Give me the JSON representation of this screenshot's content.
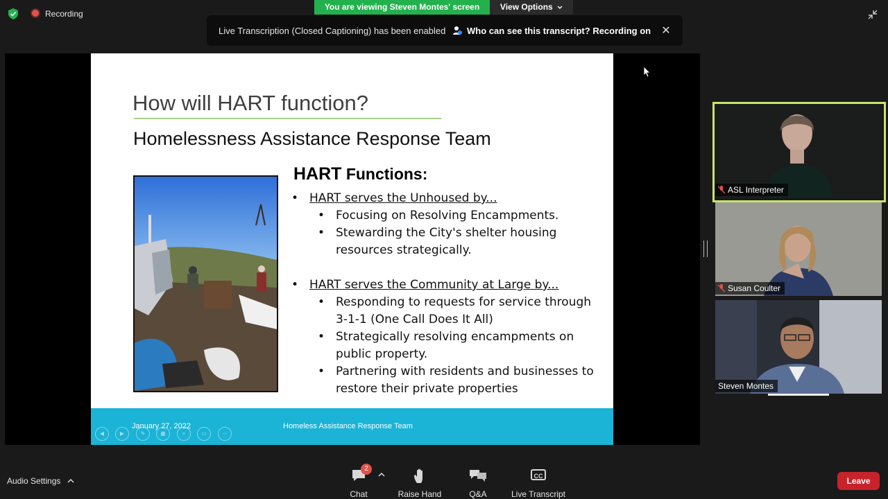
{
  "top_bar": {
    "recording_label": "Recording",
    "viewing_banner": "You are viewing Steven Montes' screen",
    "view_options_label": "View Options",
    "transcript_message": "Live Transcription (Closed Captioning) has been enabled",
    "transcript_link": "Who can see this transcript? Recording on",
    "close_glyph": "✕"
  },
  "slide": {
    "title": "How will HART function?",
    "subtitle": "Homelessness Assistance Response Team",
    "functions_heading_prefix": "HART",
    "functions_heading_suffix": " Functions:",
    "section1_heading": "HART serves the Unhoused by...",
    "section1_items": [
      "Focusing on Resolving Encampments.",
      "Stewarding the City's shelter housing",
      "resources strategically."
    ],
    "section2_heading": "HART serves the Community at Large by...",
    "section2_items": [
      "Responding to requests for service through",
      "3-1-1 (One Call Does It All)",
      "Strategically resolving encampments on",
      "public property.",
      "Partnering with residents and businesses to",
      "restore their private properties"
    ],
    "footer_date": "January 27, 2022",
    "footer_team": "Homeless Assistance Response Team",
    "footer_color": "#1bb3d6"
  },
  "participants": [
    {
      "name": "ASL Interpreter",
      "muted": true,
      "active": true
    },
    {
      "name": "Susan Coulter",
      "muted": true,
      "active": false
    },
    {
      "name": "Steven Montes",
      "muted": false,
      "active": false
    }
  ],
  "toolbar": {
    "audio_settings_label": "Audio Settings",
    "chat_label": "Chat",
    "chat_badge": "2",
    "raise_hand_label": "Raise Hand",
    "qa_label": "Q&A",
    "live_transcript_label": "Live Transcript",
    "cc_glyph": "CC",
    "leave_label": "Leave"
  },
  "colors": {
    "viewing_green": "#23b14d",
    "active_speaker_border": "#c8e46f",
    "leave_red": "#c8232b",
    "title_underline": "#a8d08d"
  }
}
